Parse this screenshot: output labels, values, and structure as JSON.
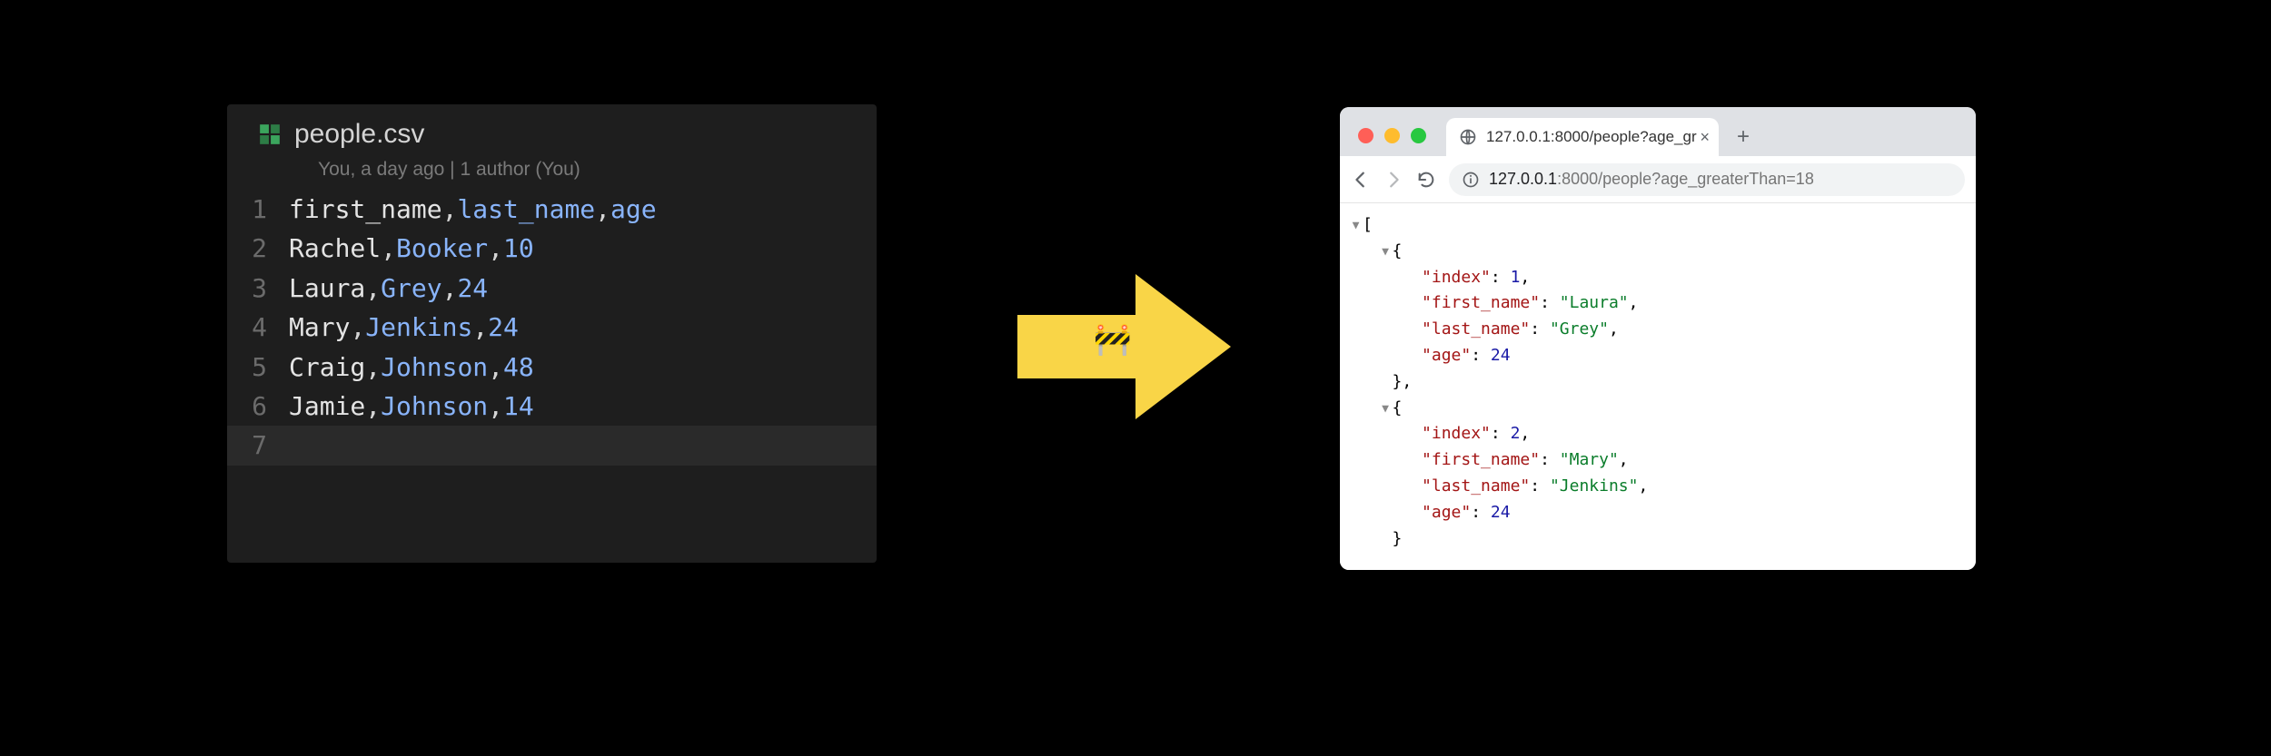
{
  "editor": {
    "filename": "people.csv",
    "blame": "You, a day ago | 1 author (You)",
    "header": [
      "first_name",
      "last_name",
      "age"
    ],
    "rows": [
      {
        "first_name": "Rachel",
        "last_name": "Booker",
        "age": "10"
      },
      {
        "first_name": "Laura",
        "last_name": "Grey",
        "age": "24"
      },
      {
        "first_name": "Mary",
        "last_name": "Jenkins",
        "age": "24"
      },
      {
        "first_name": "Craig",
        "last_name": "Johnson",
        "age": "48"
      },
      {
        "first_name": "Jamie",
        "last_name": "Johnson",
        "age": "14"
      }
    ],
    "line_count": 7,
    "current_line": 7
  },
  "arrow": {
    "emoji": "🚧",
    "fill": "#f9d547"
  },
  "browser": {
    "tab_title": "127.0.0.1:8000/people?age_gr",
    "url_host": "127.0.0.1",
    "url_port": ":8000",
    "url_path": "/people?age_greaterThan=18",
    "json": [
      {
        "index": 1,
        "first_name": "Laura",
        "last_name": "Grey",
        "age": 24
      },
      {
        "index": 2,
        "first_name": "Mary",
        "last_name": "Jenkins",
        "age": 24
      }
    ]
  }
}
